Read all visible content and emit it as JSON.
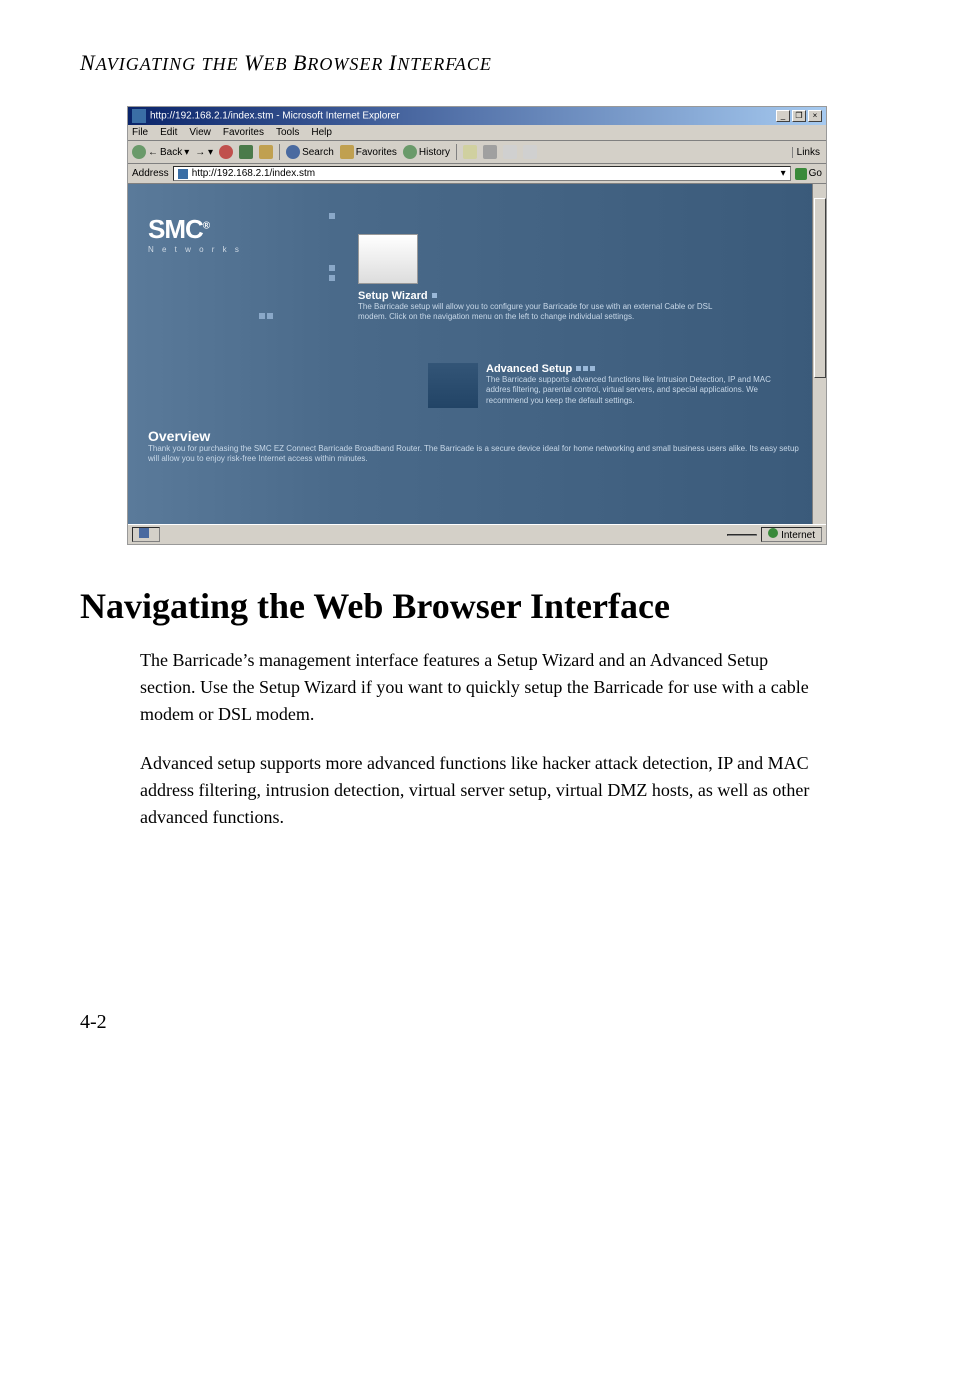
{
  "header": {
    "text": "NAVIGATING THE WEB BROWSER INTERFACE"
  },
  "ie": {
    "title": "http://192.168.2.1/index.stm - Microsoft Internet Explorer",
    "menu": {
      "file": "File",
      "edit": "Edit",
      "view": "View",
      "favorites": "Favorites",
      "tools": "Tools",
      "help": "Help"
    },
    "toolbar": {
      "back": "Back",
      "search": "Search",
      "favorites": "Favorites",
      "history": "History",
      "links": "Links"
    },
    "address": {
      "label": "Address",
      "value": "http://192.168.2.1/index.stm",
      "go": "Go"
    },
    "content": {
      "brand": "SMC",
      "brand_sub": "N e t w o r k s",
      "setup": {
        "title": "Setup Wizard",
        "desc": "The Barricade setup will allow you to configure your Barricade for use with an external Cable or DSL modem. Click on the navigation menu on the left to change individual settings."
      },
      "advanced": {
        "title": "Advanced Setup",
        "desc": "The Barricade supports advanced functions like Intrusion Detection, IP and MAC addres filtering, parental control, virtual servers, and special applications. We recommend you keep the default settings."
      },
      "overview": {
        "title": "Overview",
        "desc": "Thank you for purchasing the SMC EZ Connect Barricade Broadband Router. The Barricade is a secure device ideal for home networking and small business users alike. Its easy setup will allow you to enjoy risk-free Internet access within minutes."
      }
    },
    "status": {
      "done_icon": "e",
      "zone": "Internet"
    }
  },
  "article": {
    "heading": "Navigating the Web Browser Interface",
    "p1": "The Barricade’s management interface features a Setup Wizard and an Advanced Setup section. Use the Setup Wizard if you want to quickly setup the Barricade for use with a cable modem or DSL modem.",
    "p2": "Advanced setup supports more advanced functions like hacker attack detection, IP and MAC address filtering, intrusion detection, virtual server setup, virtual DMZ hosts, as well as other advanced functions."
  },
  "page_number": "4-2"
}
